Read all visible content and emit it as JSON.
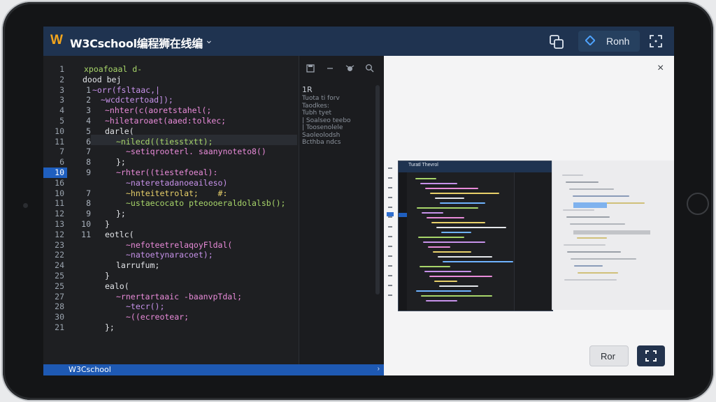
{
  "app": {
    "logo_letter": "W",
    "title": "W3Cschool编程狮在线编",
    "title_chevron": "⌄",
    "run_label": "Ronh",
    "brand_color": "#f2a51d",
    "header_color": "#1f3350"
  },
  "editor": {
    "outer_line_numbers": [
      "1",
      "2",
      "3",
      "3",
      "4",
      "5",
      "10",
      "11",
      "7",
      "6",
      "10",
      "16",
      "10",
      "11",
      "12",
      "13",
      "12",
      "23",
      "22",
      "24",
      "25",
      "25",
      "27",
      "28",
      "30",
      "21"
    ],
    "inner_line_numbers": [
      "",
      "",
      "1",
      "2",
      "3",
      "4",
      "5",
      "6",
      "7",
      "8",
      "9",
      "",
      "7",
      "8",
      "9",
      "10",
      "11",
      "",
      "",
      "",
      "",
      "",
      "",
      "",
      "",
      ""
    ],
    "code_lines": [
      {
        "text": "xpoafoaal d-",
        "color": "green"
      },
      {
        "text": "dood bej",
        "color": "white"
      },
      {
        "text": "~orr(fsltaac,|",
        "color": "purple"
      },
      {
        "text": "~wcdctertoad]);",
        "color": "purple"
      },
      {
        "text": "~nhter(c(aoretstahel(;",
        "color": "pink"
      },
      {
        "text": "~hiletaroaet(aaed:tolkec;",
        "color": "pink"
      },
      {
        "text": "darle(",
        "color": "white"
      },
      {
        "text": "~nilecd((tiesstxtt);",
        "color": "green"
      },
      {
        "text": "~setiqrooterl. saanynoteto8()",
        "color": "pink"
      },
      {
        "text": "};",
        "color": "white"
      },
      {
        "text": "~rhter((tiestefoeal):",
        "color": "pink"
      },
      {
        "text": "~nateretadanoeaileso)",
        "color": "purple"
      },
      {
        "text": "~hnteitetrolat;    #:",
        "color": "yellow"
      },
      {
        "text": "~ustaecocato pteoooeraldolalsb();",
        "color": "green"
      },
      {
        "text": "};",
        "color": "white"
      },
      {
        "text": "}",
        "color": "white"
      },
      {
        "text": "eotlc(",
        "color": "white"
      },
      {
        "text": "~nefoteetrelaqoyFldal(",
        "color": "pink"
      },
      {
        "text": "~natoetynaracoet);",
        "color": "purple"
      },
      {
        "text": "larrufum;",
        "color": "white"
      },
      {
        "text": "}",
        "color": "white"
      },
      {
        "text": "ealo(",
        "color": "white"
      },
      {
        "text": "~rnertartaaic -baanvpTdal;",
        "color": "pink"
      },
      {
        "text": "~tecr();",
        "color": "purple"
      },
      {
        "text": "~((ecreotear;",
        "color": "pink"
      },
      {
        "text": "};",
        "color": "white"
      }
    ],
    "code_lines_extra": [
      {
        "text": "};",
        "color": "white"
      },
      {
        "text": "",
        "color": "white"
      }
    ],
    "side_panel": {
      "title": "1R",
      "items": [
        "Tuota ti forv",
        "Taodkes:",
        "Tubh  tyet",
        "|  Soalseo teebo",
        "|  Toosenolele",
        "Saoleolodsh",
        "Bcthba ndcs"
      ]
    },
    "status_left": "ジ",
    "status_label": "W3Cschool",
    "status_right": "›"
  },
  "preview": {
    "close_label": "×",
    "thumbnail_title": "Turatl Thevrol",
    "run_label": "Ror",
    "accent_dark": "#23334d"
  },
  "icons": {
    "copy": "copy-windows-icon",
    "run": "run-diamond-icon",
    "fullscreen": "fullscreen-icon",
    "save": "save-icon",
    "minus": "collapse-icon",
    "bug": "debug-icon",
    "search": "search-icon",
    "close": "close-icon"
  }
}
